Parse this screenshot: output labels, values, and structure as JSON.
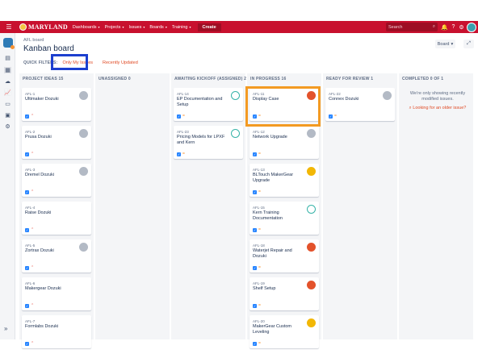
{
  "brand": {
    "word": "MARYLAND"
  },
  "nav": {
    "items": [
      {
        "label": "Dashboards",
        "caret": "▾"
      },
      {
        "label": "Projects",
        "caret": "▾"
      },
      {
        "label": "Issues",
        "caret": "▾"
      },
      {
        "label": "Boards",
        "caret": "▾"
      },
      {
        "label": "Training",
        "caret": "▾"
      }
    ],
    "create": "Create",
    "search_placeholder": "Search"
  },
  "header": {
    "breadcrumb": "AFL board",
    "title": "Kanban board",
    "board_button": "Board",
    "quick_filters_label": "QUICK FILTERS:",
    "filters": [
      "Only My Issues",
      "Recently Updated"
    ]
  },
  "columns": [
    {
      "header": "PROJECT IDEAS 15",
      "cards": [
        {
          "key": "AFL-1",
          "summary": "Ultimaker Dozuki",
          "avatar": "grey",
          "prio": "high"
        },
        {
          "key": "AFL-2",
          "summary": "Prusa Dozuki",
          "avatar": "grey",
          "prio": "high"
        },
        {
          "key": "AFL-3",
          "summary": "Dremel Dozuki",
          "avatar": "grey",
          "prio": "high"
        },
        {
          "key": "AFL-4",
          "summary": "Raise Dozuki",
          "avatar": "",
          "prio": "high"
        },
        {
          "key": "AFL-5",
          "summary": "Zortrax Dozuki",
          "avatar": "grey",
          "prio": "high"
        },
        {
          "key": "AFL-6",
          "summary": "Makergear Dozuki",
          "avatar": "",
          "prio": "high"
        },
        {
          "key": "AFL-7",
          "summary": "Formlabs Dozuki",
          "avatar": "",
          "prio": "high"
        }
      ]
    },
    {
      "header": "UNASSIGNED 0",
      "cards": []
    },
    {
      "header": "AWAITING KICKOFF (ASSIGNED) 2",
      "cards": [
        {
          "key": "AFL-14",
          "summary": "EP Documentation and Setup",
          "avatar": "teal",
          "prio": "medium"
        },
        {
          "key": "AFL-23",
          "summary": "Pricing Models for LPXF and Kern",
          "avatar": "teal",
          "prio": "medium"
        }
      ]
    },
    {
      "header": "IN PROGRESS 16",
      "cards": [
        {
          "key": "AFL-11",
          "summary": "Display Case",
          "avatar": "orange",
          "prio": "medium"
        },
        {
          "key": "AFL-12",
          "summary": "Network Upgrade",
          "avatar": "grey",
          "prio": "medium"
        },
        {
          "key": "AFL-13",
          "summary": "BLTouch MakerGear Upgrade",
          "avatar": "yellow",
          "prio": "medium"
        },
        {
          "key": "AFL-15",
          "summary": "Kern Training Documentation",
          "avatar": "teal",
          "prio": "medium"
        },
        {
          "key": "AFL-18",
          "summary": "Waterjet Repair and Dozuki",
          "avatar": "orange",
          "prio": "medium"
        },
        {
          "key": "AFL-19",
          "summary": "Shelf Setup",
          "avatar": "orange",
          "prio": "medium"
        },
        {
          "key": "AFL-20",
          "summary": "MakerGear Custom Leveling",
          "avatar": "yellow",
          "prio": "medium"
        }
      ]
    },
    {
      "header": "READY FOR REVIEW 1",
      "cards": [
        {
          "key": "AFL-22",
          "summary": "Connex Dozuki",
          "avatar": "grey",
          "prio": "medium"
        }
      ]
    },
    {
      "header": "COMPLETED 0 OF 1",
      "cards": []
    }
  ],
  "completed": {
    "note": "We're only showing recently modified issues.",
    "link": "Looking for an older issue?"
  }
}
